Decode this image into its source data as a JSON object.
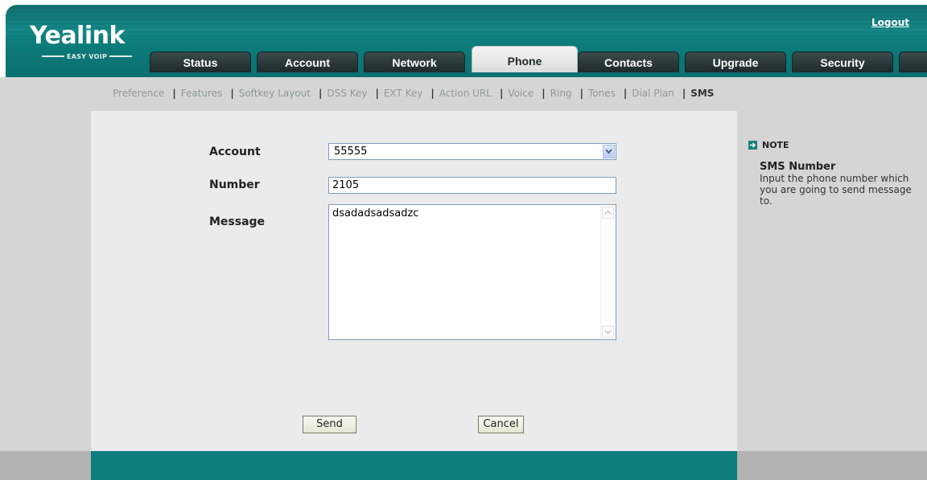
{
  "header": {
    "logo": "Yealink",
    "logo_sub": "EASY VOIP",
    "logout": "Logout"
  },
  "tabs": [
    {
      "label": "Status"
    },
    {
      "label": "Account"
    },
    {
      "label": "Network"
    },
    {
      "label": "Phone",
      "active": true
    },
    {
      "label": "Contacts"
    },
    {
      "label": "Upgrade"
    },
    {
      "label": "Security"
    }
  ],
  "subnav": [
    {
      "label": "Preference"
    },
    {
      "label": "Features"
    },
    {
      "label": "Softkey Layout"
    },
    {
      "label": "DSS Key"
    },
    {
      "label": "EXT Key"
    },
    {
      "label": "Action URL"
    },
    {
      "label": "Voice"
    },
    {
      "label": "Ring"
    },
    {
      "label": "Tones"
    },
    {
      "label": "Dial Plan"
    },
    {
      "label": "SMS",
      "active": true
    }
  ],
  "form": {
    "account_label": "Account",
    "account_value": "55555",
    "number_label": "Number",
    "number_value": "2105",
    "message_label": "Message",
    "message_value": "dsadadsadsadzc"
  },
  "buttons": {
    "send": "Send",
    "cancel": "Cancel"
  },
  "note": {
    "heading": "NOTE",
    "title": "SMS Number",
    "text": "Input the phone number which you are going to send message to."
  },
  "colors": {
    "header_teal": "#0e7c7c",
    "footer_teal": "#0d7d7d",
    "panel_grey": "#d5d5d5",
    "content_bg": "#ebebeb"
  }
}
